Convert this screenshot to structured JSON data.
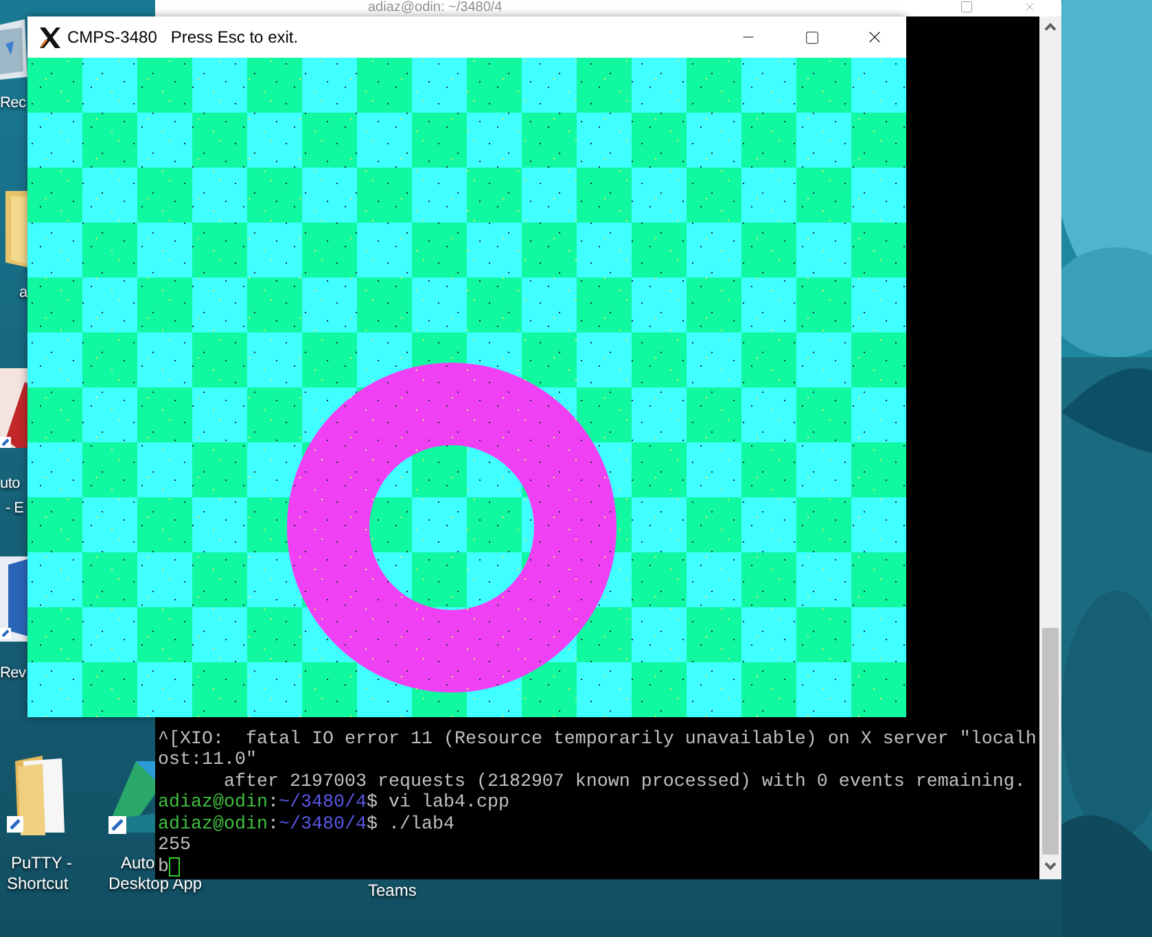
{
  "desktop_icons": [
    {
      "kind": "recycle-bin",
      "labels": [
        "Rec"
      ]
    },
    {
      "kind": "folder",
      "labels": [
        "a"
      ]
    },
    {
      "kind": "red-app",
      "labels": [
        "uto",
        "- E"
      ]
    },
    {
      "kind": "blue-app",
      "labels": [
        "Rev"
      ]
    },
    {
      "kind": "folder-shortcut",
      "labels": [
        "PuTTY -",
        "Shortcut"
      ]
    },
    {
      "kind": "triangle-app",
      "labels": [
        "Auto",
        "Desktop App"
      ]
    },
    {
      "labels": [
        "Teams"
      ]
    }
  ],
  "terminal": {
    "title": "adiaz@odin: ~/3480/4",
    "lines": [
      {
        "kind": "plain",
        "text": "^[XIO:  fatal IO error 11 (Resource temporarily unavailable) on X server \"localh"
      },
      {
        "kind": "plain",
        "text": "ost:11.0\""
      },
      {
        "kind": "plain",
        "text": "      after 2197003 requests (2182907 known processed) with 0 events remaining."
      },
      {
        "kind": "prompt",
        "user": "adiaz@odin",
        "sep": ":",
        "path": "~/3480/4",
        "command": "$ vi lab4.cpp"
      },
      {
        "kind": "prompt",
        "user": "adiaz@odin",
        "sep": ":",
        "path": "~/3480/4",
        "command": "$ ./lab4"
      },
      {
        "kind": "plain",
        "text": "255"
      },
      {
        "kind": "cursor",
        "text": "b"
      }
    ]
  },
  "x_window": {
    "title": "CMPS-3480",
    "subtitle": "Press Esc to exit."
  }
}
